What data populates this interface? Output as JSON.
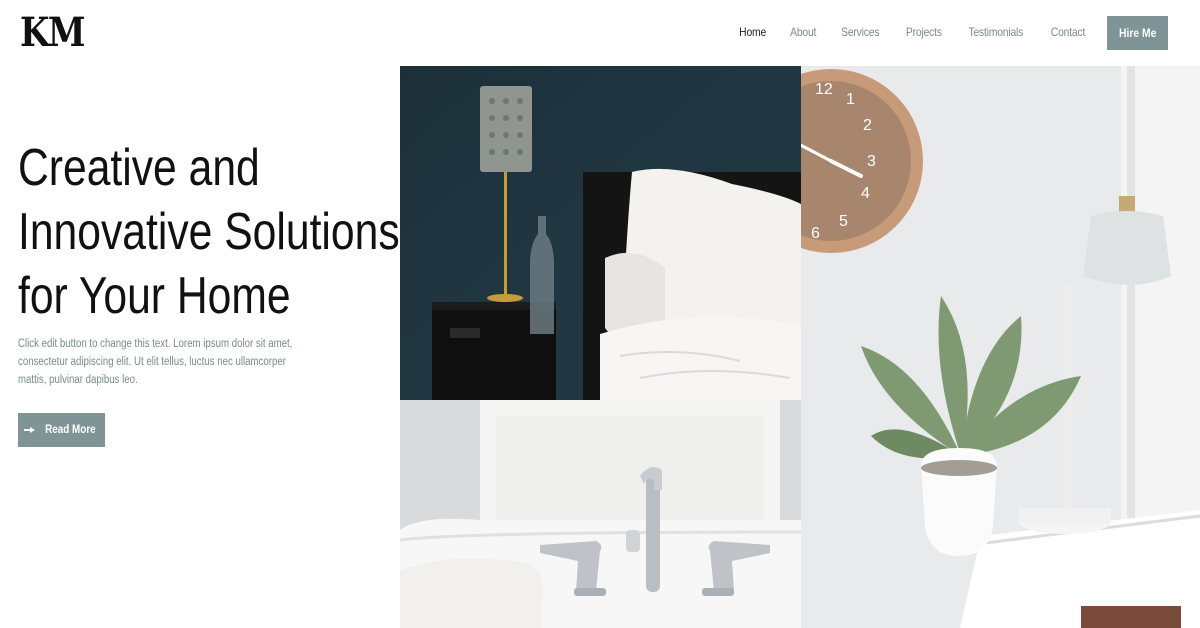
{
  "brand": {
    "logo_text": "KM"
  },
  "nav": {
    "items": [
      {
        "label": "Home",
        "active": true
      },
      {
        "label": "About",
        "active": false
      },
      {
        "label": "Services",
        "active": false
      },
      {
        "label": "Projects",
        "active": false
      },
      {
        "label": "Testimonials",
        "active": false
      },
      {
        "label": "Contact",
        "active": false
      }
    ],
    "cta_label": "Hire Me"
  },
  "hero": {
    "title_lines": [
      "Creative and",
      "Innovative Solutions",
      "for Your Home"
    ],
    "description": "Click edit button to change this text. Lorem ipsum dolor sit amet, consectetur adipiscing elit. Ut elit tellus, luctus nec ullamcorper mattis, pulvinar dapibus leo.",
    "button_label": "Read More",
    "button_icon": "arrow-right-icon"
  },
  "gallery": {
    "clock_numbers": [
      "12",
      "1",
      "2",
      "3",
      "4",
      "5",
      "6"
    ]
  },
  "colors": {
    "accent": "#7e9496",
    "nav_text": "#7a8a8d",
    "active_nav": "#222222",
    "heading": "#111111",
    "bedroom_wall": "#1f3540"
  }
}
